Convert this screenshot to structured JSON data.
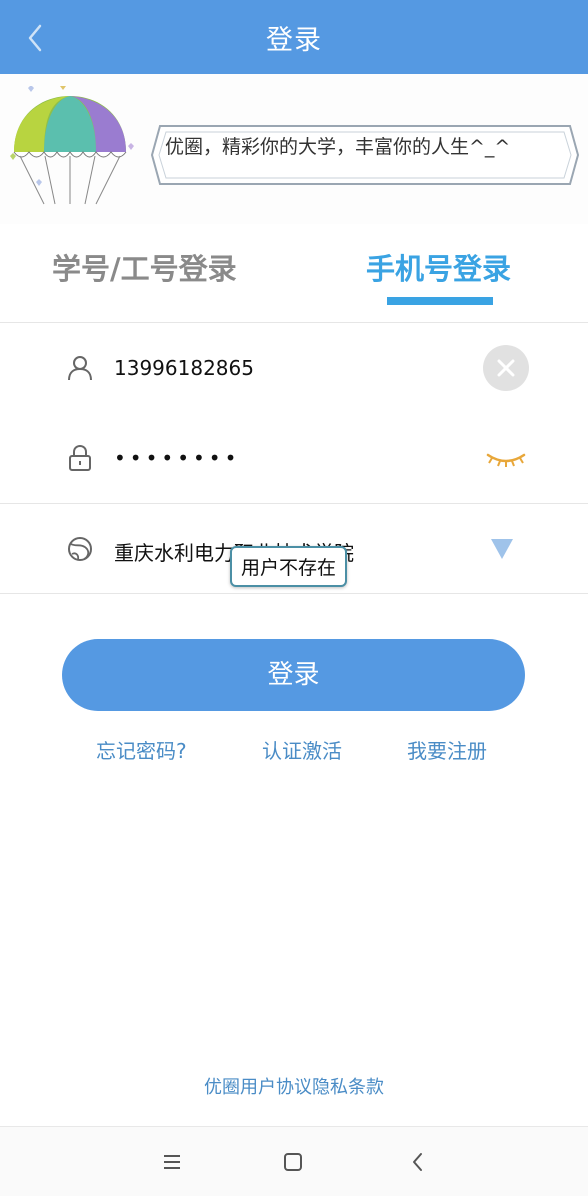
{
  "header": {
    "title": "登录",
    "back_icon": "chevron-left-icon"
  },
  "banner": {
    "slogan": "优圈，精彩你的大学，丰富你的人生^_^"
  },
  "tabs": [
    {
      "label": "学号/工号登录",
      "active": false
    },
    {
      "label": "手机号登录",
      "active": true
    }
  ],
  "form": {
    "phone": {
      "icon": "user-icon",
      "value": "13996182865",
      "clear_icon": "clear-icon"
    },
    "password": {
      "icon": "lock-icon",
      "value": "••••••••",
      "toggle_icon": "eye-closed-icon"
    },
    "school": {
      "icon": "globe-icon",
      "value": "重庆水利电力职业技术学院",
      "dropdown_icon": "triangle-down-icon"
    },
    "tooltip": "用户不存在"
  },
  "actions": {
    "login_label": "登录",
    "forgot_password": "忘记密码?",
    "activate": "认证激活",
    "register": "我要注册"
  },
  "footer": {
    "agreement": "优圈用户协议隐私条款"
  },
  "navbar": {
    "menu_icon": "menu-icon",
    "home_icon": "home-square-icon",
    "back_icon": "back-icon"
  },
  "colors": {
    "primary": "#5599e2",
    "tab_active": "#3aa3e3",
    "link": "#4a8cc6",
    "tooltip_border": "#4b8fa5"
  }
}
